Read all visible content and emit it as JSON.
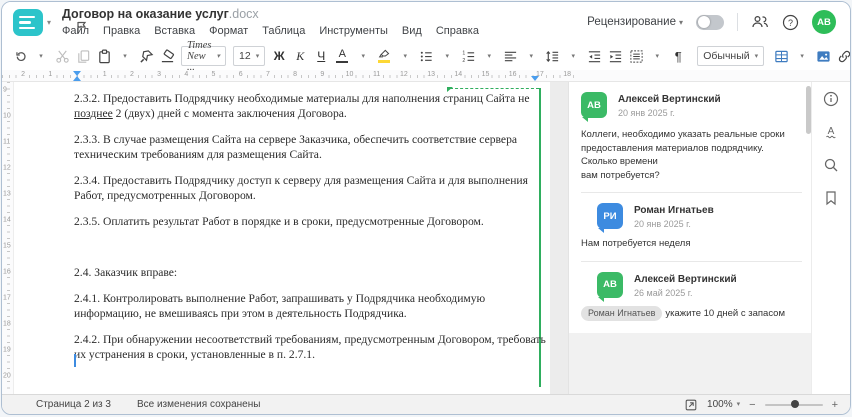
{
  "window": {
    "title": "Договор на оказание услуг",
    "title_ext": ".docx"
  },
  "menu": {
    "items": [
      "Файл",
      "Правка",
      "Вставка",
      "Формат",
      "Таблица",
      "Инструменты",
      "Вид",
      "Справка"
    ]
  },
  "header_right": {
    "review_label": "Рецензирование",
    "review_toggle_on": false,
    "avatar_initials": "АВ"
  },
  "toolbar": {
    "font_name": "Times New ...",
    "font_size": "12",
    "bold_label": "Ж",
    "italic_label": "К",
    "underline_label": "Ч",
    "font_color_label": "А",
    "style_name": "Обычный"
  },
  "glyphs": {
    "caret": "▾",
    "pilcrow": "¶",
    "more": "···",
    "minus": "−",
    "plus": "+"
  },
  "ruler": {
    "h_left": [
      "2",
      "1"
    ],
    "h_right": [
      "1",
      "2",
      "3",
      "4",
      "5",
      "6",
      "7",
      "8",
      "9",
      "10",
      "11",
      "12",
      "13",
      "14",
      "15",
      "16",
      "17",
      "18"
    ],
    "v": [
      "9",
      "10",
      "11",
      "12",
      "13",
      "14",
      "15",
      "16",
      "17",
      "18",
      "19",
      "20"
    ]
  },
  "document": {
    "p232_line1": "2.3.2. Предоставить Подрядчику необходимые материалы для наполнения страниц Сайта не\n",
    "p232_underlined": "позднее",
    "p232_rest": " 2 (двух) дней с момента заключения Договора.",
    "p233": "2.3.3. В случае размещения Сайта на сервере Заказчика, обеспечить соответствие сервера\nтехническим требованиям для размещения Сайта.",
    "p234": "2.3.4. Предоставить Подрядчику доступ к серверу для размещения Сайта и для выполнения\nРабот, предусмотренных Договором.",
    "p235": "2.3.5. Оплатить результат Работ в порядке и в сроки, предусмотренные Договором.",
    "p24": "2.4. Заказчик вправе:",
    "p241": "2.4.1. Контролировать выполнение Работ, запрашивать у Подрядчика необходимую\nинформацию, не вмешиваясь при этом в деятельность Подрядчика.",
    "p242": "2.4.2. При обнаружении несоответствий требованиям, предусмотренным Договором, требовать\nих устранения в сроки, установленные в п. 2.7.1."
  },
  "comments": {
    "thread": [
      {
        "initials": "АВ",
        "author": "Алексей Вертинский",
        "date": "20 янв 2025 г.",
        "text": "Коллеги, необходимо указать реальные сроки\nпредоставления материалов подрядчику. Сколько времени\nвам потребуется?"
      },
      {
        "initials": "РИ",
        "author": "Роман Игнатьев",
        "date": "20 янв 2025 г.",
        "text": "Нам потребуется неделя"
      },
      {
        "initials": "АВ",
        "author": "Алексей Вертинский",
        "date": "26 май 2025 г.",
        "mention": "Роман Игнатьев",
        "text": "укажите 10 дней с запасом"
      }
    ]
  },
  "status_bar": {
    "page_info": "Страница 2 из 3",
    "saved_info": "Все изменения сохранены",
    "zoom_level": "100%"
  },
  "colors": {
    "brand_teal": "#2cc4ca",
    "avatar_green": "#3bba66",
    "avatar_blue": "#3d8be0",
    "accent_blue": "#3f7cc0",
    "anchor_green": "#2fae5e",
    "highlight_yellow": "#fdd835"
  }
}
